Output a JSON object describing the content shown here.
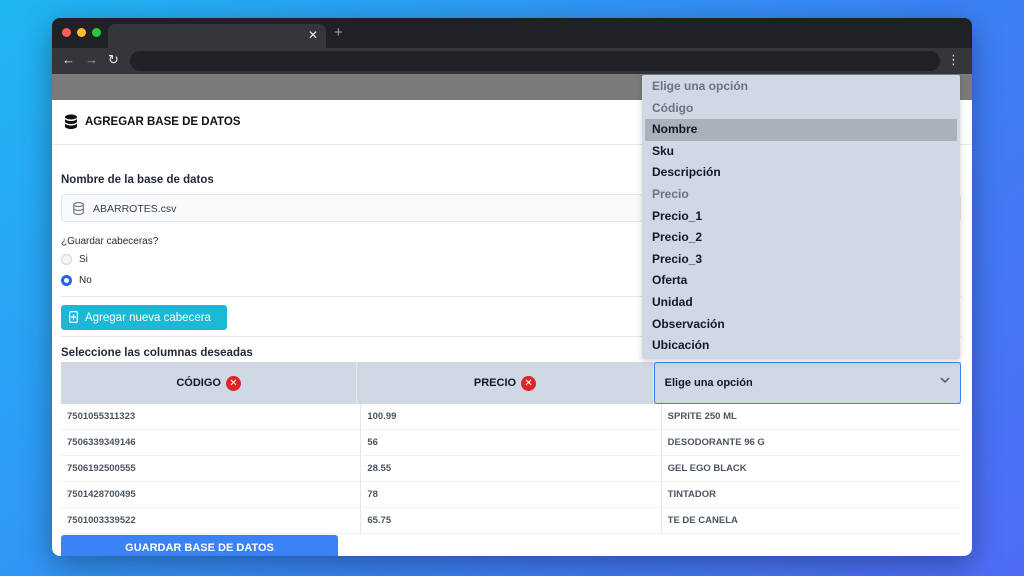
{
  "header": {
    "title": "AGREGAR BASE DE DATOS"
  },
  "form": {
    "db_name_label": "Nombre de la base de datos",
    "db_name_value": "ABARROTES.csv",
    "save_headers_label": "¿Guardar cabeceras?",
    "radio_si": "Si",
    "radio_no": "No",
    "radio_selected": "No",
    "add_header_button": "Agregar nueva cabecera",
    "select_columns_label": "Seleccione las columnas deseadas",
    "save_button": "GUARDAR BASE DE DATOS"
  },
  "table": {
    "columns": [
      {
        "label": "CÓDIGO",
        "removable": true
      },
      {
        "label": "PRECIO",
        "removable": true
      },
      {
        "label": "Elige una opción",
        "select": true
      }
    ],
    "rows": [
      [
        "7501055311323",
        "100.99",
        "SPRITE 250 ML"
      ],
      [
        "7506339349146",
        "56",
        "DESODORANTE 96 G"
      ],
      [
        "7506192500555",
        "28.55",
        "GEL EGO BLACK"
      ],
      [
        "7501428700495",
        "78",
        "TINTADOR"
      ],
      [
        "7501003339522",
        "65.75",
        "TE DE CANELA"
      ]
    ]
  },
  "dropdown": {
    "options": [
      {
        "label": "Elige una opción",
        "disabled": true
      },
      {
        "label": "Código",
        "disabled": true
      },
      {
        "label": "Nombre",
        "active": true
      },
      {
        "label": "Sku"
      },
      {
        "label": "Descripción"
      },
      {
        "label": "Precio",
        "disabled": true
      },
      {
        "label": "Precio_1"
      },
      {
        "label": "Precio_2"
      },
      {
        "label": "Precio_3"
      },
      {
        "label": "Oferta"
      },
      {
        "label": "Unidad"
      },
      {
        "label": "Observación"
      },
      {
        "label": "Ubicación"
      }
    ]
  },
  "colors": {
    "accent_blue": "#3b82f6",
    "cyan_button": "#1db8d6",
    "remove_red": "#dc2626",
    "header_gray": "#cfd8e3"
  }
}
